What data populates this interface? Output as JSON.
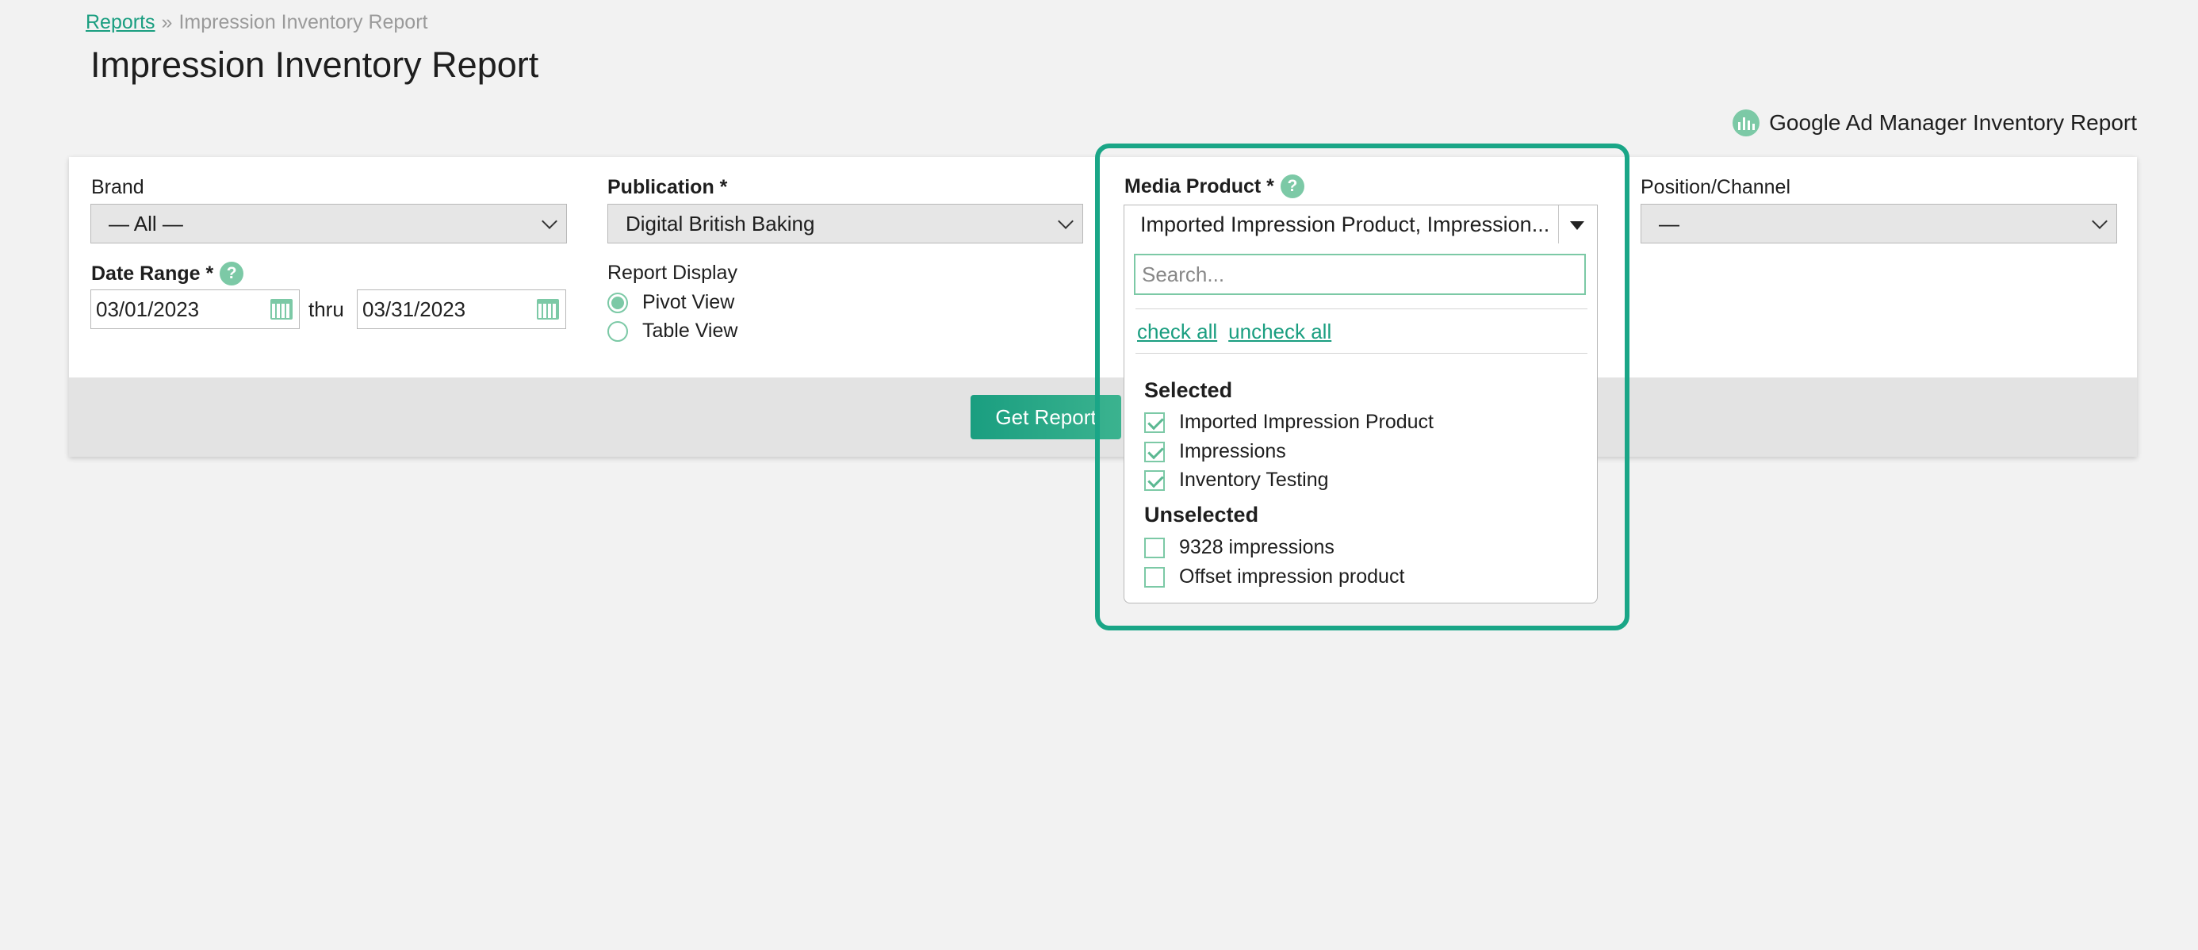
{
  "breadcrumb": {
    "root": "Reports",
    "separator": "»",
    "current": "Impression Inventory Report"
  },
  "page_title": "Impression Inventory Report",
  "gam_link": {
    "label": "Google Ad Manager Inventory Report",
    "icon": "bar-chart-icon"
  },
  "filters": {
    "brand": {
      "label": "Brand",
      "value": "— All —"
    },
    "publication": {
      "label": "Publication *",
      "value": "Digital British Baking"
    },
    "media_product": {
      "label": "Media Product *",
      "value": "Imported Impression Product, Impression..."
    },
    "position": {
      "label": "Position/Channel",
      "value": "—"
    },
    "date_range": {
      "label": "Date Range *",
      "start": "03/01/2023",
      "separator": "thru",
      "end": "03/31/2023"
    },
    "report_display": {
      "label": "Report Display",
      "options": [
        "Pivot View",
        "Table View"
      ],
      "selected": "Pivot View"
    }
  },
  "get_report_label": "Get Report",
  "multiselect": {
    "search_placeholder": "Search...",
    "check_all": "check all",
    "uncheck_all": "uncheck all",
    "selected_heading": "Selected",
    "selected_items": [
      "Imported Impression Product",
      "Impressions",
      "Inventory Testing"
    ],
    "unselected_heading": "Unselected",
    "unselected_items": [
      "9328 impressions",
      "Offset impression product"
    ]
  },
  "colors": {
    "accent": "#1a9e80",
    "highlight": "#1aa687",
    "checkbox": "#7cc9a6"
  }
}
